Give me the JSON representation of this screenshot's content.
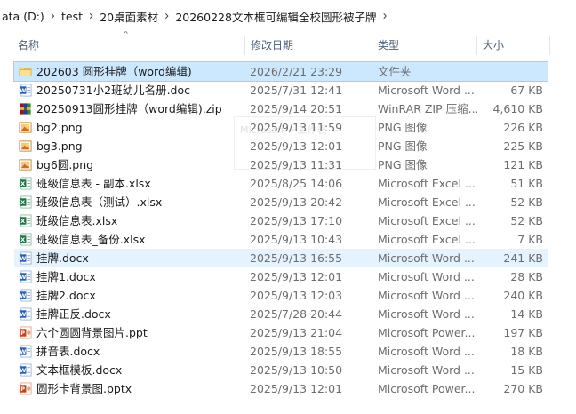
{
  "breadcrumb": [
    "ata (D:)",
    "test",
    "20桌面素材",
    "20260228文本框可编辑全校圆形被子牌"
  ],
  "columns": {
    "name": "名称",
    "date": "修改日期",
    "type": "类型",
    "size": "大小"
  },
  "ghost_label": "Microsoft 一工作表",
  "files": [
    {
      "icon": "folder-icon",
      "name": "202603 圆形挂牌（word编辑)",
      "date": "2026/2/21 23:29",
      "type": "文件夹",
      "size": ""
    },
    {
      "icon": "word-doc-icon",
      "name": "20250731小2班幼儿名册.doc",
      "date": "2025/7/31 12:41",
      "type": "Microsoft Word ...",
      "size": "67 KB"
    },
    {
      "icon": "winrar-zip-icon",
      "name": "20250913圆形挂牌（word编辑).zip",
      "date": "2025/9/14 20:51",
      "type": "WinRAR ZIP 压缩...",
      "size": "4,610 KB"
    },
    {
      "icon": "png-image-icon",
      "name": "bg2.png",
      "date": "2025/9/13 11:59",
      "type": "PNG 图像",
      "size": "226 KB"
    },
    {
      "icon": "png-image-icon",
      "name": "bg3.png",
      "date": "2025/9/13 12:01",
      "type": "PNG 图像",
      "size": "225 KB"
    },
    {
      "icon": "png-image-icon",
      "name": "bg6圆.png",
      "date": "2025/9/13 11:31",
      "type": "PNG 图像",
      "size": "121 KB"
    },
    {
      "icon": "excel-icon",
      "name": "班级信息表 - 副本.xlsx",
      "date": "2025/8/25 14:06",
      "type": "Microsoft Excel ...",
      "size": "51 KB"
    },
    {
      "icon": "excel-icon",
      "name": "班级信息表（测试）.xlsx",
      "date": "2025/9/13 20:42",
      "type": "Microsoft Excel ...",
      "size": "52 KB"
    },
    {
      "icon": "excel-icon",
      "name": "班级信息表.xlsx",
      "date": "2025/9/13 17:10",
      "type": "Microsoft Excel ...",
      "size": "52 KB"
    },
    {
      "icon": "excel-icon",
      "name": "班级信息表_备份.xlsx",
      "date": "2025/9/13 10:43",
      "type": "Microsoft Excel ...",
      "size": "7 KB"
    },
    {
      "icon": "word-docx-icon",
      "name": "挂牌.docx",
      "date": "2025/9/13 16:55",
      "type": "Microsoft Word ...",
      "size": "241 KB"
    },
    {
      "icon": "word-docx-icon",
      "name": "挂牌1.docx",
      "date": "2025/9/13 12:01",
      "type": "Microsoft Word ...",
      "size": "28 KB"
    },
    {
      "icon": "word-docx-icon",
      "name": "挂牌2.docx",
      "date": "2025/9/13 12:03",
      "type": "Microsoft Word ...",
      "size": "240 KB"
    },
    {
      "icon": "word-docx-icon",
      "name": "挂牌正反.docx",
      "date": "2025/7/28 20:44",
      "type": "Microsoft Word ...",
      "size": "14 KB"
    },
    {
      "icon": "powerpoint-icon",
      "name": "六个圆圆背景图片.ppt",
      "date": "2025/9/13 21:04",
      "type": "Microsoft Power...",
      "size": "197 KB"
    },
    {
      "icon": "word-docx-icon",
      "name": "拼音表.docx",
      "date": "2025/9/13 18:55",
      "type": "Microsoft Word ...",
      "size": "18 KB"
    },
    {
      "icon": "word-docx-icon",
      "name": "文本框模板.docx",
      "date": "2025/9/13 10:50",
      "type": "Microsoft Word ...",
      "size": "15 KB"
    },
    {
      "icon": "powerpoint-icon",
      "name": "圆形卡背景图.pptx",
      "date": "2025/9/13 12:01",
      "type": "Microsoft Power...",
      "size": "270 KB"
    }
  ],
  "selected_index": 0,
  "hover_index": 10,
  "colors": {
    "selected_bg": "#cce8ff",
    "hover_bg": "#e5f3ff",
    "folder": "#f8d775",
    "word": "#2b5fb4",
    "excel": "#1f7244",
    "powerpoint": "#c8411b",
    "winrar": "#8b1a1a"
  }
}
